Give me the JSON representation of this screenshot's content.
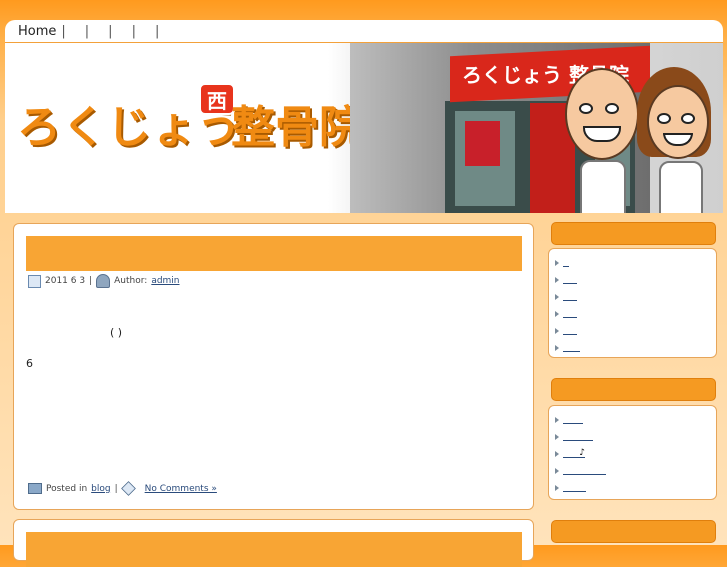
{
  "nav": {
    "home_label": "Home",
    "separator": "|"
  },
  "header": {
    "logo_main": "ろくじょう",
    "logo_badge": "西",
    "logo_suffix": "整骨院",
    "store_sign": "ろくじょう 整骨院"
  },
  "post1": {
    "date": "2011 6 3",
    "separator": "|",
    "author_prefix": "Author:",
    "author": "admin",
    "body_line1": "( )",
    "body_line2": "6",
    "posted_in": "Posted in",
    "category": "blog",
    "comments_label": "No Comments »"
  },
  "sidebar": {
    "box1_items": [
      "",
      "",
      "",
      "",
      "",
      ""
    ],
    "box2_items": [
      "",
      "",
      "♪",
      "",
      ""
    ]
  },
  "colors": {
    "accent": "#f8a534",
    "sidebar_head": "#f59a22",
    "link": "#2a4b7c"
  }
}
